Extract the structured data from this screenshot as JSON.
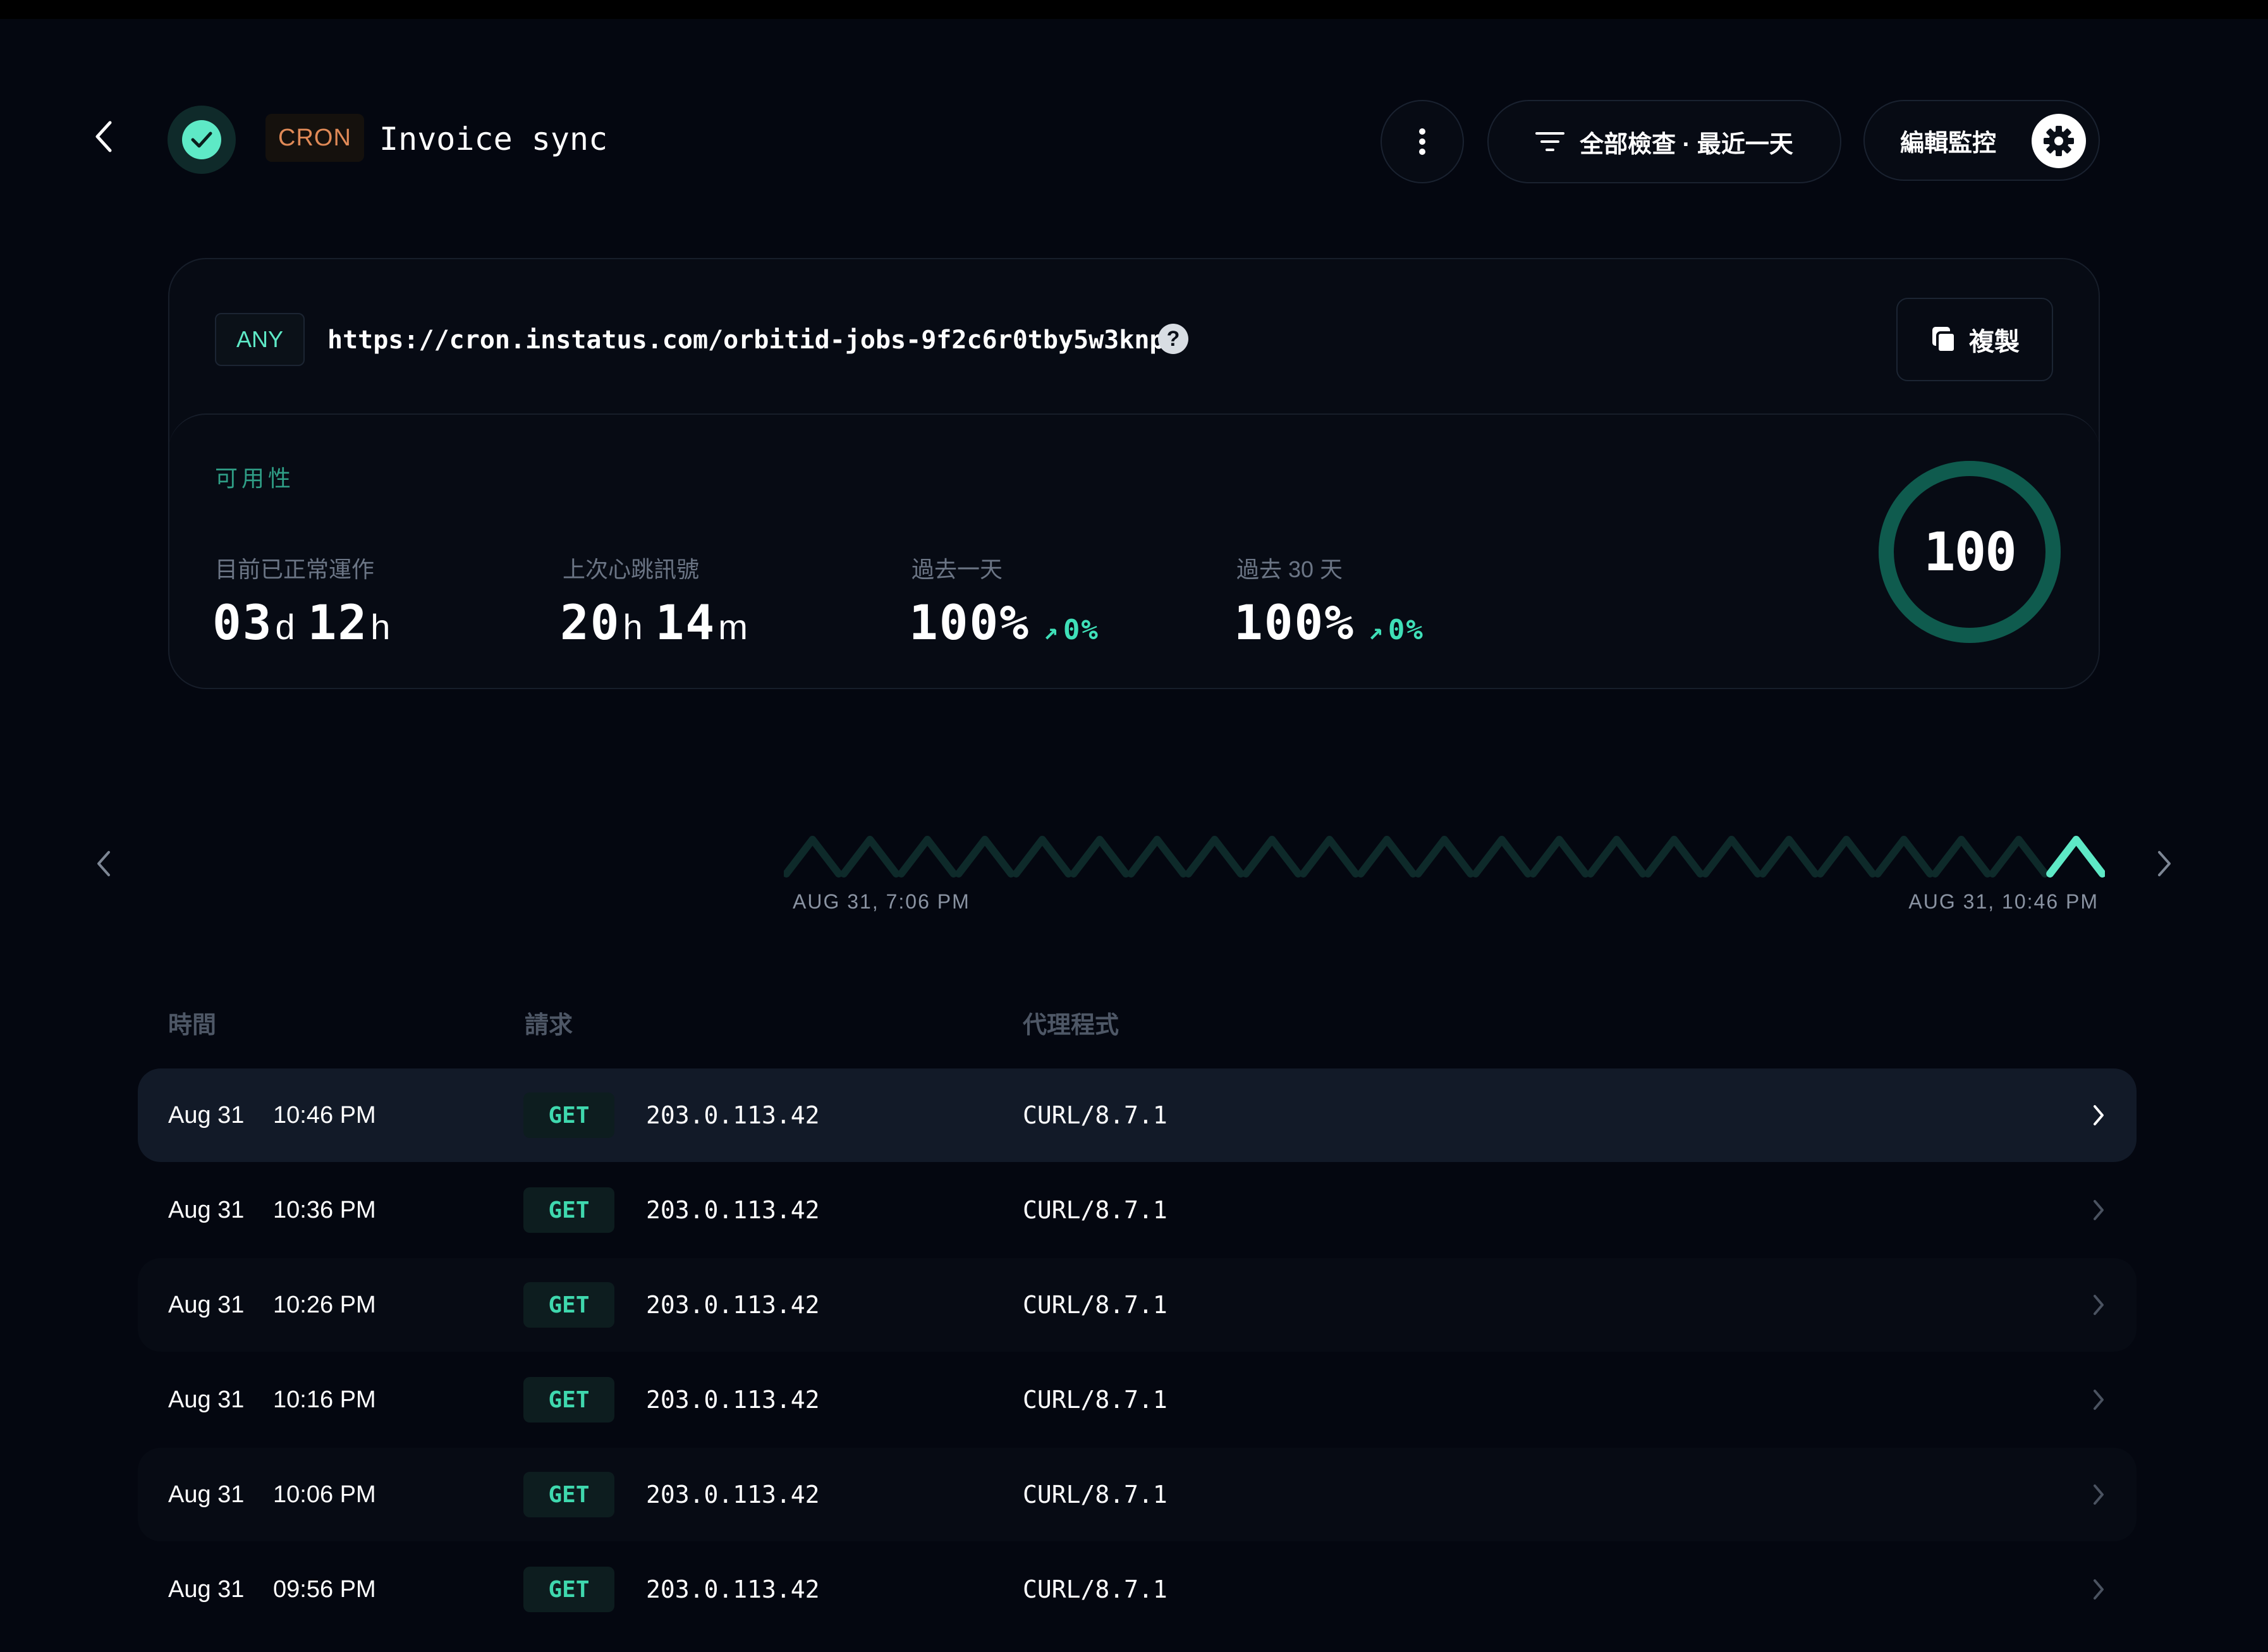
{
  "header": {
    "type_badge": "CRON",
    "title": "Invoice sync",
    "filter_label": "全部檢查 · 最近一天",
    "edit_label": "編輯監控"
  },
  "endpoint": {
    "method_badge": "ANY",
    "url": "https://cron.instatus.com/orbitid-jobs-9f2c6r0tby5w3knp",
    "help": "?",
    "copy_label": "複製"
  },
  "availability": {
    "title": "可用性",
    "stats": [
      {
        "label": "目前已正常運作",
        "v1": "03",
        "u1": "d",
        "v2": "12",
        "u2": "h"
      },
      {
        "label": "上次心跳訊號",
        "v1": "20",
        "u1": "h",
        "v2": "14",
        "u2": "m"
      },
      {
        "label": "過去一天",
        "value": "100%",
        "delta": "0%"
      },
      {
        "label": "過去 30 天",
        "value": "100%",
        "delta": "0%"
      }
    ],
    "score": "100",
    "score_fraction": 1.0,
    "ring_color": "#0f5b4e"
  },
  "timeline": {
    "start_label": "AUG 31, 7:06 PM",
    "end_label": "AUG 31, 10:46 PM",
    "heartbeat_count": 23,
    "inactive_color": "#0e2a2a",
    "active_color": "#5ee9c6"
  },
  "table": {
    "columns": [
      "時間",
      "請求",
      "代理程式"
    ],
    "rows": [
      {
        "date": "Aug 31",
        "time": "10:46 PM",
        "method": "GET",
        "ip": "203.0.113.42",
        "agent": "CURL/8.7.1"
      },
      {
        "date": "Aug 31",
        "time": "10:36 PM",
        "method": "GET",
        "ip": "203.0.113.42",
        "agent": "CURL/8.7.1"
      },
      {
        "date": "Aug 31",
        "time": "10:26 PM",
        "method": "GET",
        "ip": "203.0.113.42",
        "agent": "CURL/8.7.1"
      },
      {
        "date": "Aug 31",
        "time": "10:16 PM",
        "method": "GET",
        "ip": "203.0.113.42",
        "agent": "CURL/8.7.1"
      },
      {
        "date": "Aug 31",
        "time": "10:06 PM",
        "method": "GET",
        "ip": "203.0.113.42",
        "agent": "CURL/8.7.1"
      },
      {
        "date": "Aug 31",
        "time": "09:56 PM",
        "method": "GET",
        "ip": "203.0.113.42",
        "agent": "CURL/8.7.1"
      }
    ]
  },
  "colors": {
    "accent": "#5ee9c6",
    "cron": "#e08a57",
    "background": "#040710"
  }
}
